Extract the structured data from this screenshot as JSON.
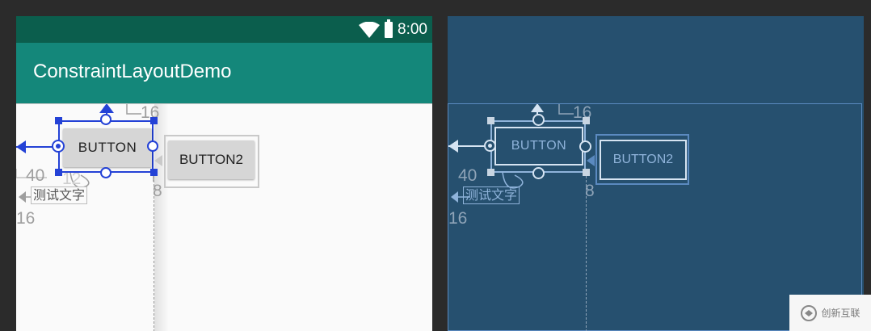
{
  "status_bar": {
    "time": "8:00"
  },
  "app_bar": {
    "title": "ConstraintLayoutDemo"
  },
  "design": {
    "button_main": "BUTTON",
    "button2": "BUTTON2",
    "text_label": "测试文字",
    "margins": {
      "top": "16",
      "right": "8",
      "left_text": "40",
      "left_bottom": "16",
      "small": "12"
    }
  },
  "blueprint": {
    "button_main": "BUTTON",
    "button2": "BUTTON2",
    "text_label": "测试文字",
    "margins": {
      "top": "16",
      "right": "8",
      "left_text": "40",
      "left_bottom": "16"
    }
  },
  "watermark": {
    "text": "创新互联"
  },
  "colors": {
    "status_bar": "#0b5e4d",
    "app_bar": "#14877a",
    "selection": "#2442d6",
    "blueprint_bg": "#26506f"
  }
}
